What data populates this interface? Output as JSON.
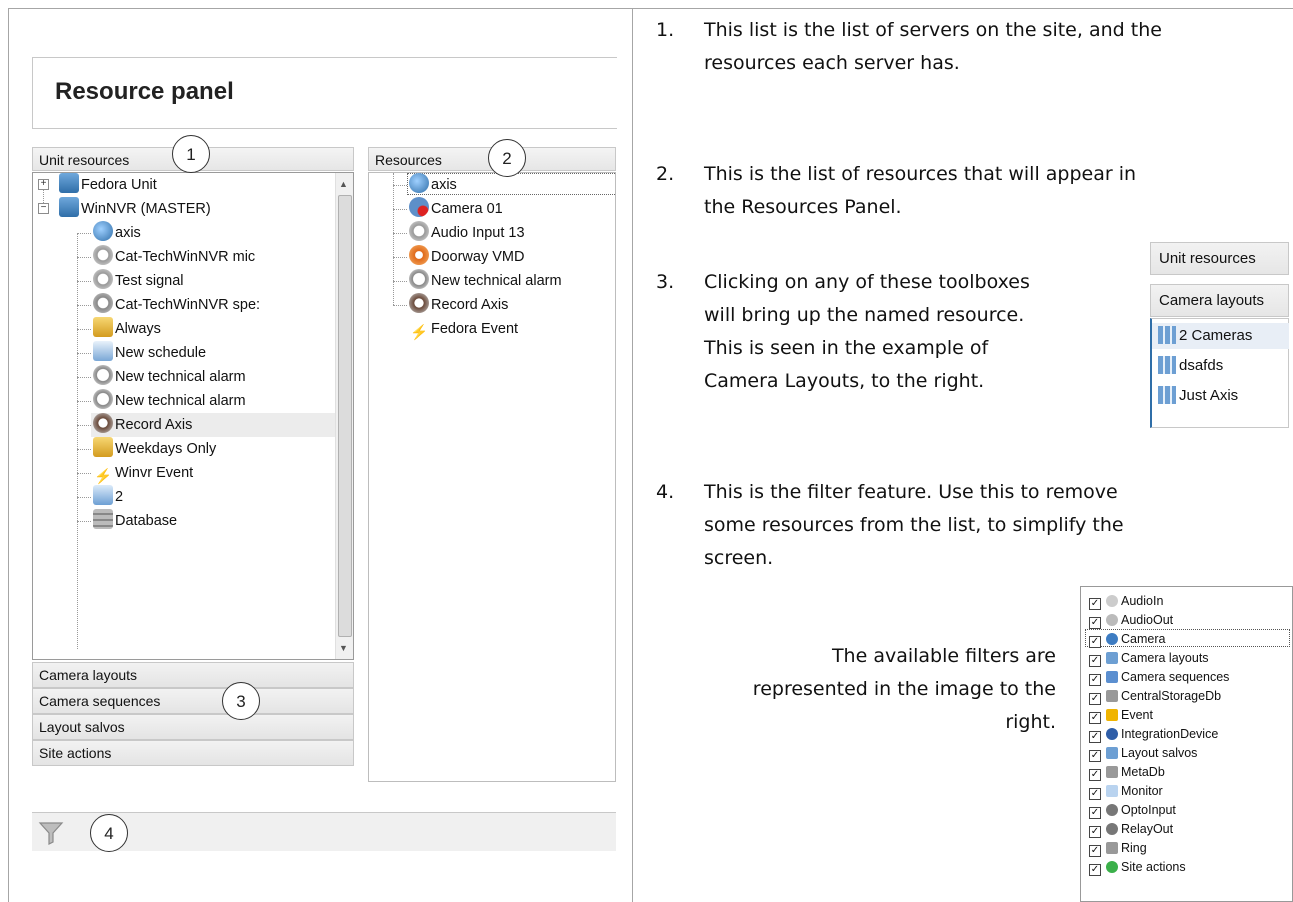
{
  "screenshot": {
    "title": "Resource panel",
    "unit_resources_header": "Unit resources",
    "resources_header": "Resources",
    "unit_tree": [
      {
        "label": "Fedora Unit",
        "icon": "server-icon",
        "level": 0,
        "expander": "+"
      },
      {
        "label": "WinNVR (MASTER)",
        "icon": "server-icon",
        "level": 0,
        "expander": "−"
      },
      {
        "label": "axis",
        "icon": "camera-icon",
        "level": 1
      },
      {
        "label": "Cat-TechWinNVR mic",
        "icon": "microphone-icon",
        "level": 1
      },
      {
        "label": "Test signal",
        "icon": "microphone-icon",
        "level": 1
      },
      {
        "label": "Cat-TechWinNVR spe:",
        "icon": "speaker-icon",
        "level": 1
      },
      {
        "label": "Always",
        "icon": "schedule-icon",
        "level": 1
      },
      {
        "label": "New schedule",
        "icon": "calendar-icon",
        "level": 1
      },
      {
        "label": "New technical alarm",
        "icon": "wrench-icon",
        "level": 1
      },
      {
        "label": "New technical alarm",
        "icon": "wrench-icon",
        "level": 1
      },
      {
        "label": "Record Axis",
        "icon": "record-icon",
        "level": 1
      },
      {
        "label": "Weekdays Only",
        "icon": "schedule-icon",
        "level": 1
      },
      {
        "label": "Winvr Event",
        "icon": "lightning-icon",
        "level": 1
      },
      {
        "label": "2",
        "icon": "monitor-icon",
        "level": 1
      },
      {
        "label": "Database",
        "icon": "database-icon",
        "level": 1
      }
    ],
    "resources_tree": [
      {
        "label": "axis",
        "icon": "camera-icon"
      },
      {
        "label": "Camera 01",
        "icon": "camera-alert-icon"
      },
      {
        "label": "Audio Input 13",
        "icon": "microphone-icon"
      },
      {
        "label": "Doorway VMD",
        "icon": "motion-icon"
      },
      {
        "label": "New technical alarm",
        "icon": "wrench-icon"
      },
      {
        "label": "Record Axis",
        "icon": "record-icon"
      },
      {
        "label": "Fedora Event",
        "icon": "lightning-icon"
      }
    ],
    "toolboxes": [
      "Camera layouts",
      "Camera sequences",
      "Layout salvos",
      "Site actions"
    ],
    "callouts": [
      "1",
      "2",
      "3",
      "4"
    ],
    "filter_icon": "funnel-icon"
  },
  "notes": [
    {
      "num": "1.",
      "lines": [
        "This list is the list of servers on the site, and the",
        "resources each server has."
      ]
    },
    {
      "num": "2.",
      "lines": [
        "This is the list of resources that will appear in",
        "the Resources Panel."
      ]
    },
    {
      "num": "3.",
      "lines": [
        "Clicking on any of these toolboxes",
        "will bring up the named resource.",
        "This is seen in the example of",
        "Camera Layouts, to the right."
      ]
    },
    {
      "num": "4.",
      "lines": [
        "This is the filter feature. Use this to remove",
        "some resources from the list, to simplify the",
        "screen."
      ]
    }
  ],
  "filters_caption": [
    "The available filters are",
    "represented in the image to the",
    "right."
  ],
  "camera_layouts_example": {
    "headers": [
      "Unit resources",
      "Camera layouts"
    ],
    "items": [
      "2 Cameras",
      "dsafds",
      "Just Axis"
    ]
  },
  "filter_list": [
    {
      "label": "AudioIn",
      "icon": "microphone-icon",
      "checked": true
    },
    {
      "label": "AudioOut",
      "icon": "speaker-icon",
      "checked": true
    },
    {
      "label": "Camera",
      "icon": "camera-icon",
      "checked": true
    },
    {
      "label": "Camera layouts",
      "icon": "layout-icon",
      "checked": true
    },
    {
      "label": "Camera sequences",
      "icon": "sequence-icon",
      "checked": true
    },
    {
      "label": "CentralStorageDb",
      "icon": "database-icon",
      "checked": true
    },
    {
      "label": "Event",
      "icon": "lightning-icon",
      "checked": true
    },
    {
      "label": "IntegrationDevice",
      "icon": "device-icon",
      "checked": true
    },
    {
      "label": "Layout salvos",
      "icon": "salvo-icon",
      "checked": true
    },
    {
      "label": "MetaDb",
      "icon": "database-icon",
      "checked": true
    },
    {
      "label": "Monitor",
      "icon": "monitor-icon",
      "checked": true
    },
    {
      "label": "OptoInput",
      "icon": "input-icon",
      "checked": true
    },
    {
      "label": "RelayOut",
      "icon": "relay-icon",
      "checked": true
    },
    {
      "label": "Ring",
      "icon": "ring-icon",
      "checked": true
    },
    {
      "label": "Site actions",
      "icon": "play-icon",
      "checked": true
    }
  ]
}
